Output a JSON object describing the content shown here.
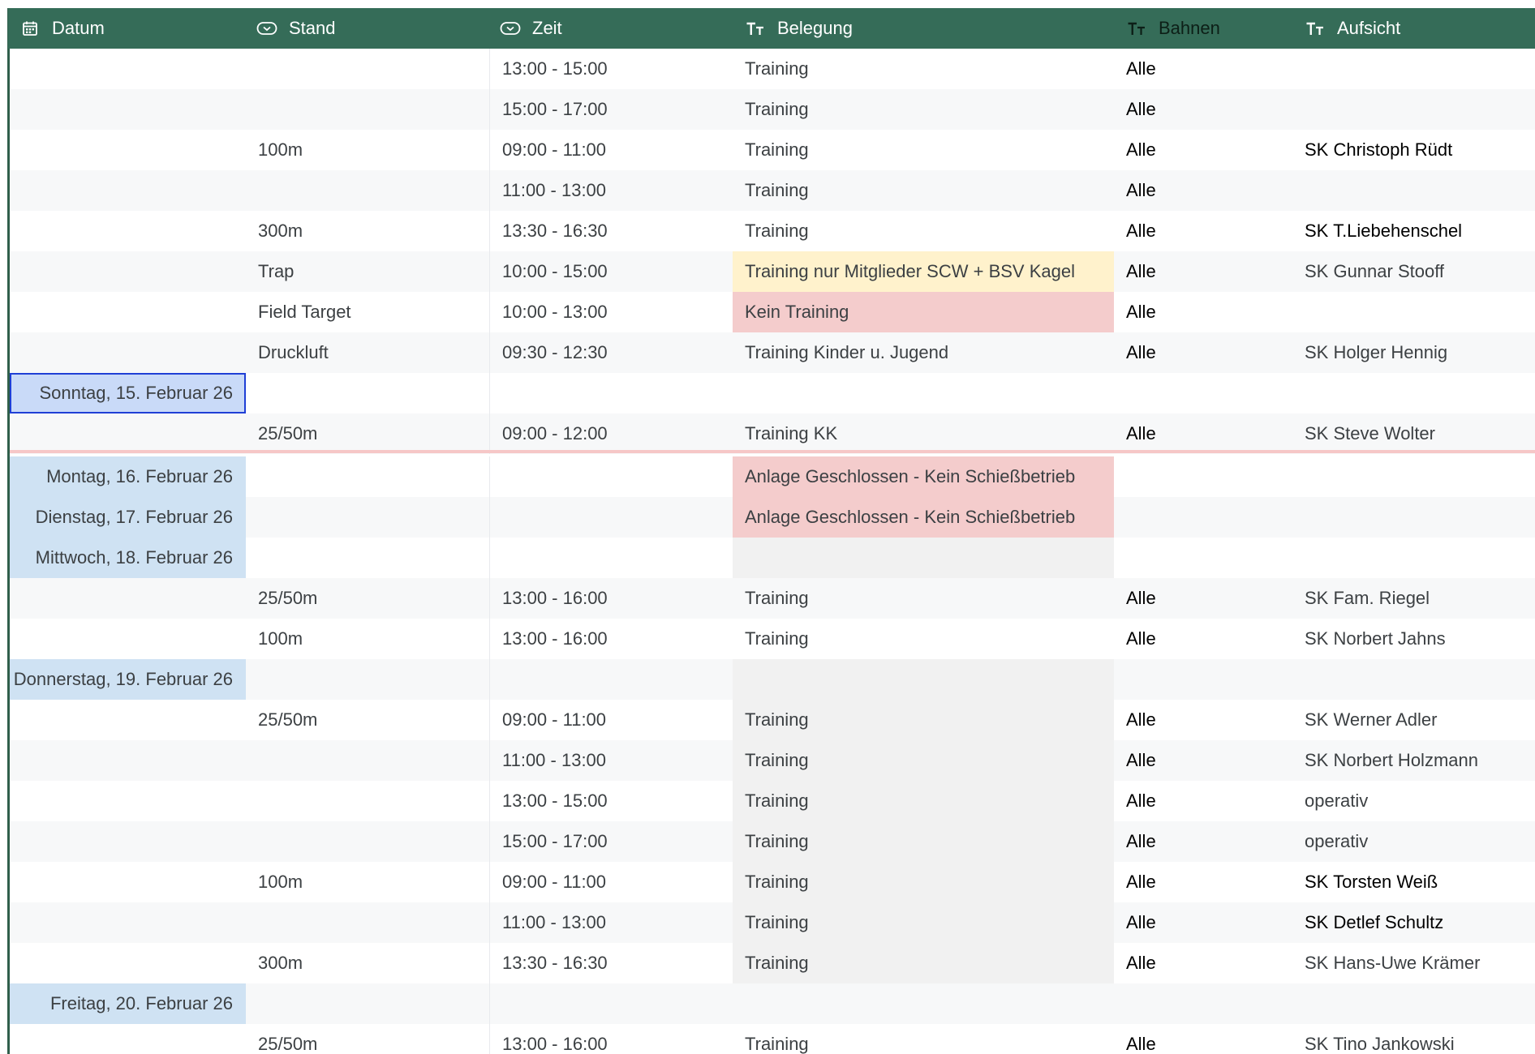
{
  "header": {
    "columns": [
      {
        "key": "datum",
        "label": "Datum",
        "icon": "calendar-icon"
      },
      {
        "key": "stand",
        "label": "Stand",
        "icon": "dropdown-chip-icon"
      },
      {
        "key": "zeit",
        "label": "Zeit",
        "icon": "dropdown-chip-icon"
      },
      {
        "key": "belegung",
        "label": "Belegung",
        "icon": "text-type-icon"
      },
      {
        "key": "bahnen",
        "label": "Bahnen",
        "icon": "text-type-icon"
      },
      {
        "key": "aufsicht",
        "label": "Aufsicht",
        "icon": "text-type-icon"
      }
    ]
  },
  "colors": {
    "header_bg": "#356c58",
    "date_highlight": "#cfe2f3",
    "selected_cell": "#c9daf8",
    "selection_border": "#1f3fd6",
    "belegung_yellow": "#fff2cc",
    "belegung_red": "#f4cccc",
    "belegung_grey": "#f1f1f1"
  },
  "rows": [
    {
      "datum": "",
      "stand": "",
      "zeit": "13:00 - 15:00",
      "belegung": "Training",
      "bahnen": "Alle",
      "aufsicht": ""
    },
    {
      "datum": "",
      "stand": "",
      "zeit": "15:00 - 17:00",
      "belegung": "Training",
      "bahnen": "Alle",
      "aufsicht": ""
    },
    {
      "datum": "",
      "stand": "100m",
      "zeit": "09:00 - 11:00",
      "belegung": "Training",
      "bahnen": "Alle",
      "aufsicht": "SK Christoph Rüdt",
      "aufsicht_black": true
    },
    {
      "datum": "",
      "stand": "",
      "zeit": "11:00 - 13:00",
      "belegung": "Training",
      "bahnen": "Alle",
      "aufsicht": ""
    },
    {
      "datum": "",
      "stand": "300m",
      "zeit": "13:30 - 16:30",
      "belegung": "Training",
      "bahnen": "Alle",
      "aufsicht": "SK T.Liebehenschel",
      "aufsicht_black": true
    },
    {
      "datum": "",
      "stand": "Trap",
      "zeit": "10:00 - 15:00",
      "belegung": "Training nur Mitglieder SCW + BSV Kagel",
      "belegung_style": "yellow",
      "bahnen": "Alle",
      "aufsicht": "SK Gunnar Stooff"
    },
    {
      "datum": "",
      "stand": "Field Target",
      "zeit": "10:00 - 13:00",
      "belegung": "Kein Training",
      "belegung_style": "red",
      "bahnen": "Alle",
      "aufsicht": ""
    },
    {
      "datum": "",
      "stand": "Druckluft",
      "zeit": "09:30 - 12:30",
      "belegung": "Training Kinder u. Jugend",
      "bahnen": "Alle",
      "aufsicht": "SK Holger Hennig"
    },
    {
      "datum": "Sonntag, 15. Februar 26",
      "datum_style": "selected",
      "stand": "",
      "zeit": "",
      "belegung": "",
      "bahnen": "",
      "aufsicht": "",
      "bg": "white"
    },
    {
      "datum": "",
      "stand": "25/50m",
      "zeit": "09:00 - 12:00",
      "belegung": "Training KK",
      "bahnen": "Alle",
      "aufsicht": "SK Steve Wolter"
    },
    {
      "datum": "Montag, 16. Februar 26",
      "datum_style": "blue",
      "stand": "",
      "zeit": "",
      "belegung": "Anlage Geschlossen - Kein Schießbetrieb",
      "belegung_style": "red",
      "bahnen": "",
      "aufsicht": ""
    },
    {
      "datum": "Dienstag, 17. Februar 26",
      "datum_style": "blue",
      "stand": "",
      "zeit": "",
      "belegung": "Anlage Geschlossen - Kein Schießbetrieb",
      "belegung_style": "red",
      "bahnen": "",
      "aufsicht": ""
    },
    {
      "datum": "Mittwoch, 18. Februar 26",
      "datum_style": "blue",
      "stand": "",
      "zeit": "",
      "belegung": "",
      "belegung_style": "grey",
      "bahnen": "",
      "aufsicht": ""
    },
    {
      "datum": "",
      "stand": "25/50m",
      "zeit": "13:00 - 16:00",
      "belegung": "Training",
      "bahnen": "Alle",
      "aufsicht": "SK Fam. Riegel"
    },
    {
      "datum": "",
      "stand": "100m",
      "zeit": "13:00 - 16:00",
      "belegung": "Training",
      "bahnen": "Alle",
      "aufsicht": "SK Norbert Jahns"
    },
    {
      "datum": "Donnerstag, 19. Februar 26",
      "datum_style": "blue",
      "stand": "",
      "zeit": "",
      "belegung": "",
      "belegung_style": "grey",
      "bahnen": "",
      "aufsicht": ""
    },
    {
      "datum": "",
      "stand": "25/50m",
      "zeit": "09:00 - 11:00",
      "belegung": "Training",
      "belegung_style": "grey",
      "bahnen": "Alle",
      "aufsicht": "SK Werner Adler"
    },
    {
      "datum": "",
      "stand": "",
      "zeit": "11:00 - 13:00",
      "belegung": "Training",
      "belegung_style": "grey",
      "bahnen": "Alle",
      "aufsicht": "SK Norbert Holzmann"
    },
    {
      "datum": "",
      "stand": "",
      "zeit": "13:00 - 15:00",
      "belegung": "Training",
      "belegung_style": "grey",
      "bahnen": "Alle",
      "aufsicht": "operativ"
    },
    {
      "datum": "",
      "stand": "",
      "zeit": "15:00 - 17:00",
      "belegung": "Training",
      "belegung_style": "grey",
      "bahnen": "Alle",
      "aufsicht": "operativ"
    },
    {
      "datum": "",
      "stand": "100m",
      "zeit": "09:00 - 11:00",
      "belegung": "Training",
      "belegung_style": "grey",
      "bahnen": "Alle",
      "aufsicht": "SK Torsten Weiß",
      "aufsicht_black": true
    },
    {
      "datum": "",
      "stand": "",
      "zeit": "11:00 - 13:00",
      "belegung": "Training",
      "belegung_style": "grey",
      "bahnen": "Alle",
      "aufsicht": "SK Detlef Schultz",
      "aufsicht_black": true
    },
    {
      "datum": "",
      "stand": "300m",
      "zeit": "13:30 - 16:30",
      "belegung": "Training",
      "belegung_style": "grey",
      "bahnen": "Alle",
      "aufsicht": "SK Hans-Uwe Krämer"
    },
    {
      "datum": "Freitag, 20. Februar 26",
      "datum_style": "blue",
      "stand": "",
      "zeit": "",
      "belegung": "",
      "bahnen": "",
      "aufsicht": ""
    },
    {
      "datum": "",
      "stand": "25/50m",
      "zeit": "13:00 - 16:00",
      "belegung": "Training",
      "bahnen": "Alle",
      "aufsicht": "SK Tino Jankowski"
    }
  ]
}
